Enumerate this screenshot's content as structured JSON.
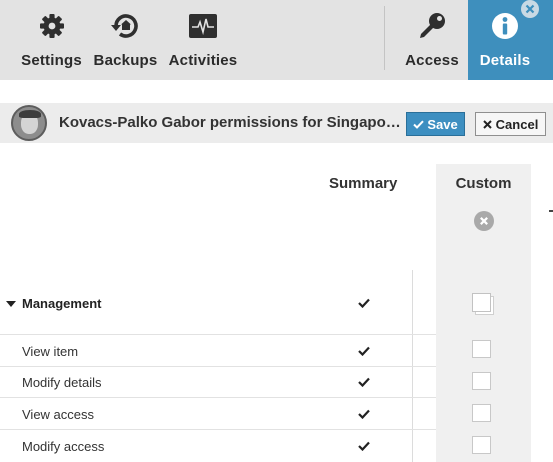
{
  "toolbar": {
    "items": [
      {
        "label": "Settings",
        "icon": "gear-icon"
      },
      {
        "label": "Backups",
        "icon": "backup-icon"
      },
      {
        "label": "Activities",
        "icon": "activity-icon"
      },
      {
        "label": "Access",
        "icon": "key-icon"
      },
      {
        "label": "Details",
        "icon": "info-icon",
        "active": true
      }
    ],
    "active_color": "#3e8fbd"
  },
  "header": {
    "title": "Kovacs-Palko Gabor permissions for Singapor...",
    "save_label": "Save",
    "cancel_label": "Cancel"
  },
  "table": {
    "columns": {
      "summary": "Summary",
      "custom": "Custom"
    },
    "group": {
      "label": "Management",
      "summary_checked": true
    },
    "rows": [
      {
        "label": "View item",
        "summary_checked": true,
        "custom_checked": false
      },
      {
        "label": "Modify details",
        "summary_checked": true,
        "custom_checked": false
      },
      {
        "label": "View access",
        "summary_checked": true,
        "custom_checked": false
      },
      {
        "label": "Modify access",
        "summary_checked": true,
        "custom_checked": false
      }
    ]
  }
}
